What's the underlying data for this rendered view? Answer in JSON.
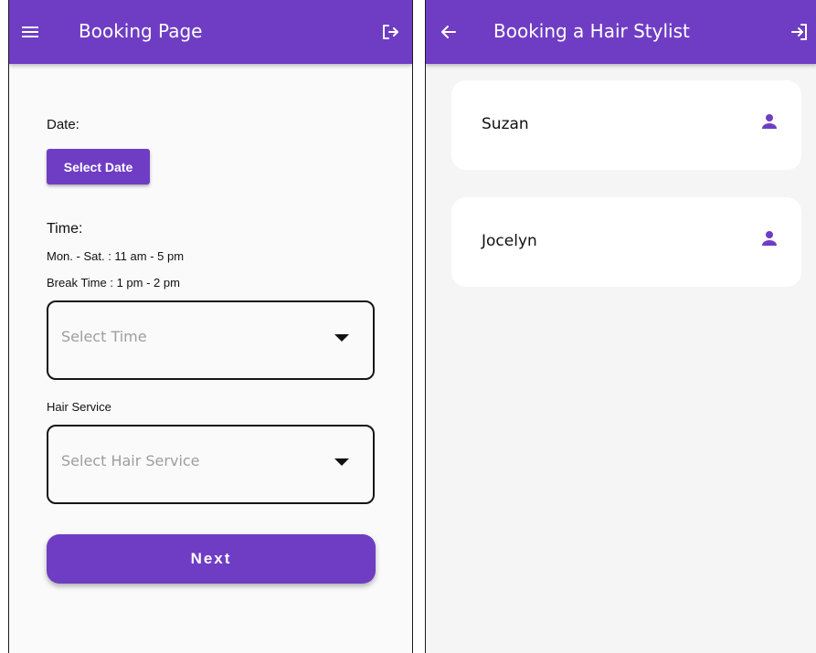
{
  "colors": {
    "primary": "#6f3dc4",
    "on_primary": "#ffffff",
    "outline": "#151515",
    "placeholder": "#9e9e9e"
  },
  "booking_page": {
    "appbar": {
      "title": "Booking Page",
      "menu_icon": "hamburger-menu-icon",
      "logout_icon": "logout-icon"
    },
    "date_label": "Date:",
    "select_date_button": "Select Date",
    "time_label": "Time:",
    "hours": "Mon. - Sat. : 11 am - 5 pm",
    "break_time": "Break Time : 1 pm - 2 pm",
    "time_dropdown": {
      "placeholder": "Select Time"
    },
    "service_label": "Hair Service",
    "service_dropdown": {
      "placeholder": "Select Hair Service"
    },
    "next_button": "Next"
  },
  "stylist_page": {
    "appbar": {
      "title": "Booking a Hair Stylist",
      "back_icon": "arrow-back-icon",
      "login_icon": "login-icon"
    },
    "stylists": [
      {
        "name": "Suzan",
        "icon": "person-icon"
      },
      {
        "name": "Jocelyn",
        "icon": "person-icon"
      }
    ]
  }
}
